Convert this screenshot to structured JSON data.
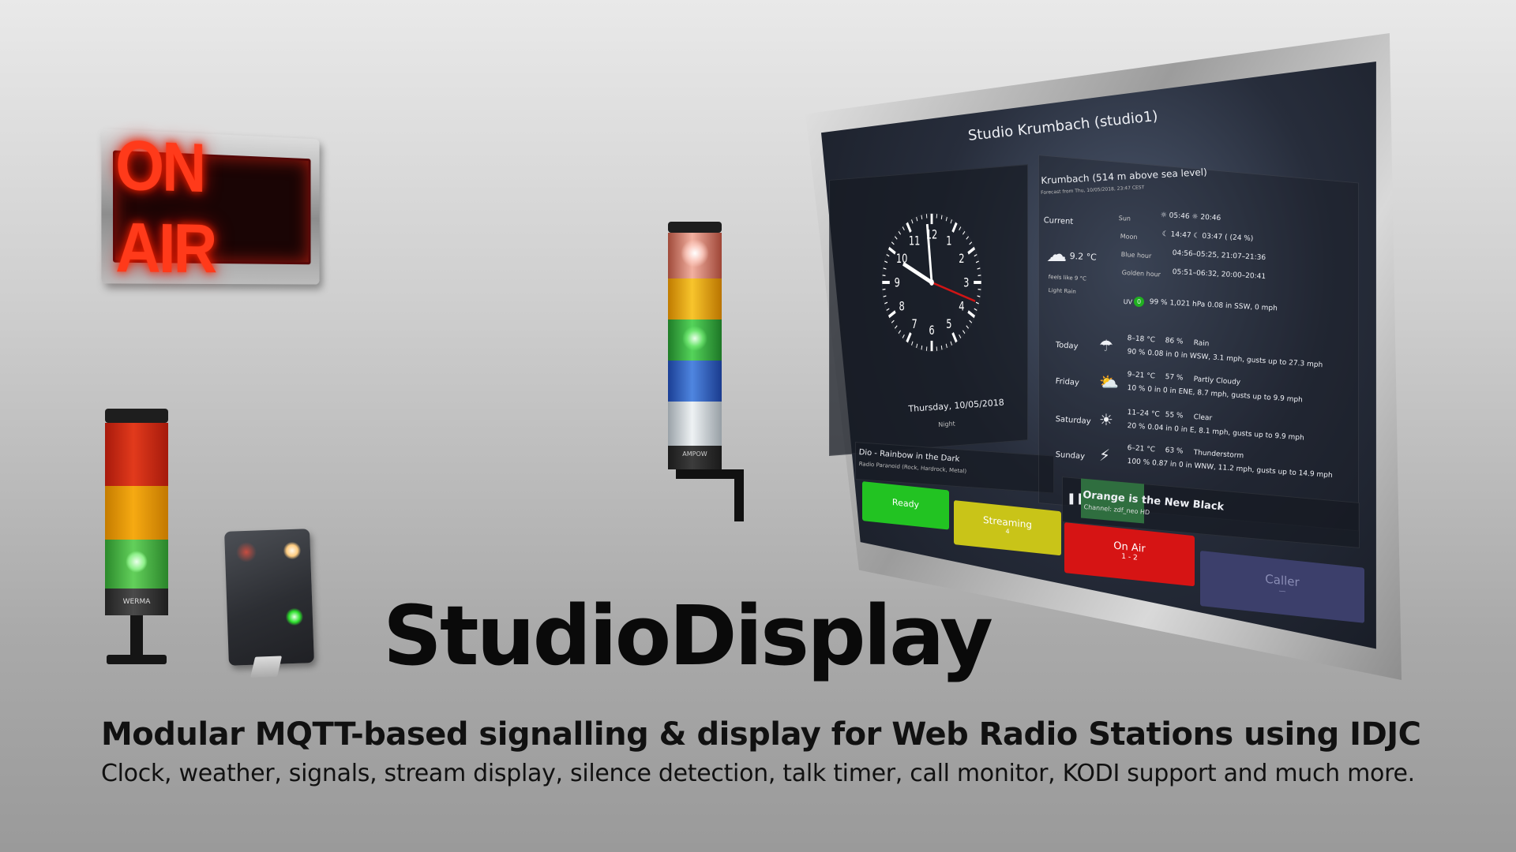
{
  "onair_sign": {
    "text": "ON AIR"
  },
  "stack_lights": {
    "left_brand": "WERMA",
    "middle_brand": "AMPOW"
  },
  "screen": {
    "header": "Studio Krumbach (studio1)",
    "clock": {
      "numerals": [
        "12",
        "1",
        "2",
        "3",
        "4",
        "5",
        "6",
        "7",
        "8",
        "9",
        "10",
        "11"
      ],
      "date": "Thursday, 10/05/2018",
      "period": "Night"
    },
    "stream": {
      "title": "Dio - Rainbow in the Dark",
      "subtitle": "Radio Paranoid (Rock, Hardrock, Metal)"
    },
    "weather": {
      "location": "Krumbach (514 m above sea level)",
      "forecast_from": "Forecast from Thu, 10/05/2018, 23:47 CEST",
      "current_label": "Current",
      "current_temp": "9.2 °C",
      "feels_like": "feels like 9 °C",
      "condition": "Light Rain",
      "sun_label": "Sun",
      "sun_values": "☼ 05:46   ☼ 20:46",
      "moon_label": "Moon",
      "moon_values": "☾ 14:47   ☾ 03:47   ( (24 %)",
      "blue_label": "Blue hour",
      "blue_values": "04:56–05:25, 21:07–21:36",
      "golden_label": "Golden hour",
      "golden_values": "05:51–06:32, 20:00–20:41",
      "uv_label": "UV",
      "uv_value": "0",
      "stats": "99 %   1,021 hPa   0.08 in   SSW, 0 mph",
      "days": [
        {
          "name": "Today",
          "temps": "8–18 °C",
          "humidity": "86 %",
          "cond": "Rain",
          "line2": "90 % 0.08 in   0 in   WSW, 3.1 mph, gusts up to 27.3 mph"
        },
        {
          "name": "Friday",
          "temps": "9–21 °C",
          "humidity": "57 %",
          "cond": "Partly Cloudy",
          "line2": "10 % 0 in   0 in   ENE, 8.7 mph, gusts up to 9.9 mph"
        },
        {
          "name": "Saturday",
          "temps": "11–24 °C",
          "humidity": "55 %",
          "cond": "Clear",
          "line2": "20 % 0.04 in   0 in   E, 8.1 mph, gusts up to 9.9 mph"
        },
        {
          "name": "Sunday",
          "temps": "6–21 °C",
          "humidity": "63 %",
          "cond": "Thunderstorm",
          "line2": "100 % 0.87 in   0 in   WNW, 11.2 mph, gusts up to 14.9 mph"
        }
      ]
    },
    "kodi": {
      "title": "Orange is the New Black",
      "channel": "Channel: zdf_neo HD"
    },
    "signals": [
      {
        "label": "Ready",
        "sub": "",
        "color": "#22c322"
      },
      {
        "label": "Streaming",
        "sub": "4",
        "color": "#c9c418"
      },
      {
        "label": "On Air",
        "sub": "1 - 2",
        "color": "#d61414"
      },
      {
        "label": "Caller",
        "sub": "—",
        "color": "#3c3f6b"
      }
    ]
  },
  "title": "StudioDisplay",
  "subtitle": "Modular MQTT-based signalling & display for Web Radio Stations using IDJC",
  "description": "Clock, weather, signals, stream display, silence detection, talk timer, call monitor, KODI support and much more."
}
